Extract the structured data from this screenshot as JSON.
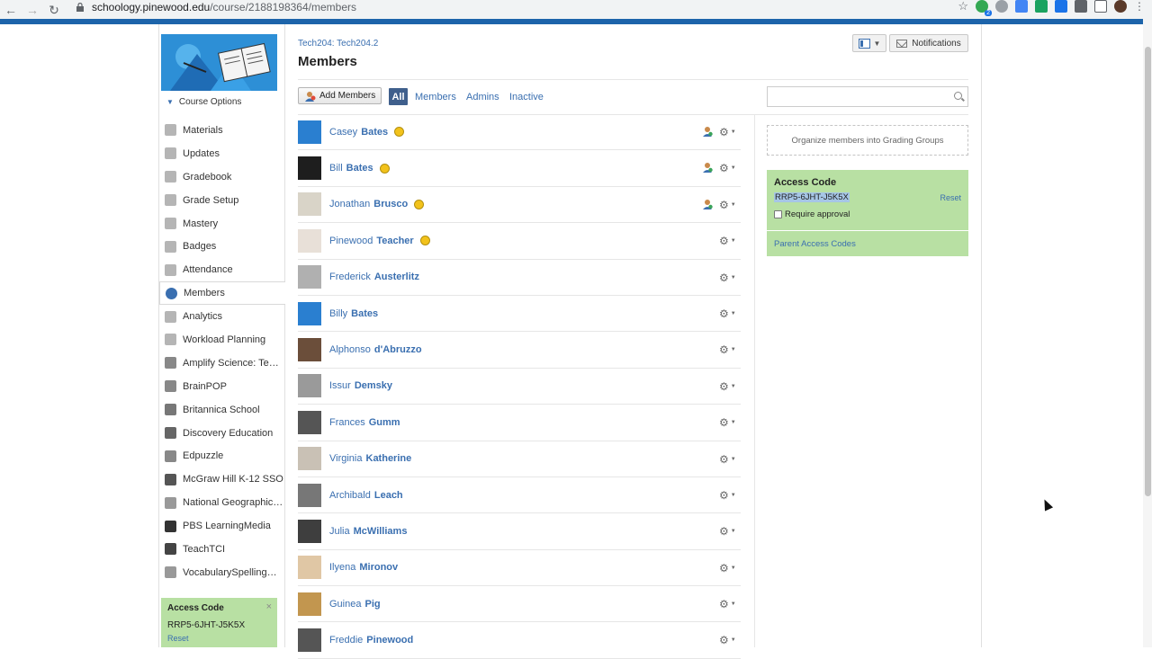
{
  "browser": {
    "url_host": "schoology.pinewood.edu",
    "url_path": "/course/2188198364/members",
    "extension_badge": "2"
  },
  "sidebar": {
    "course_options": "Course Options",
    "items": [
      {
        "label": "Materials",
        "icon": "materials-icon"
      },
      {
        "label": "Updates",
        "icon": "updates-icon"
      },
      {
        "label": "Gradebook",
        "icon": "gradebook-icon"
      },
      {
        "label": "Grade Setup",
        "icon": "grade-setup-icon"
      },
      {
        "label": "Mastery",
        "icon": "mastery-icon"
      },
      {
        "label": "Badges",
        "icon": "badges-icon"
      },
      {
        "label": "Attendance",
        "icon": "attendance-icon"
      },
      {
        "label": "Members",
        "icon": "members-icon"
      },
      {
        "label": "Analytics",
        "icon": "analytics-icon"
      },
      {
        "label": "Workload Planning",
        "icon": "workload-icon"
      },
      {
        "label": "Amplify Science: Teach...",
        "icon": "amplify-icon"
      },
      {
        "label": "BrainPOP",
        "icon": "brainpop-icon"
      },
      {
        "label": "Britannica School",
        "icon": "britannica-icon"
      },
      {
        "label": "Discovery Education",
        "icon": "discovery-icon"
      },
      {
        "label": "Edpuzzle",
        "icon": "edpuzzle-icon"
      },
      {
        "label": "McGraw Hill K-12 SSO",
        "icon": "mcgraw-icon"
      },
      {
        "label": "National Geographic Ki...",
        "icon": "natgeo-icon"
      },
      {
        "label": "PBS LearningMedia",
        "icon": "pbs-icon"
      },
      {
        "label": "TeachTCI",
        "icon": "tci-icon"
      },
      {
        "label": "VocabularySpellingCity",
        "icon": "vocab-icon"
      }
    ],
    "access": {
      "title": "Access Code",
      "code": "RRP5-6JHT-J5K5X",
      "reset": "Reset",
      "close": "×"
    }
  },
  "header": {
    "breadcrumb": "Tech204: Tech204.2",
    "title": "Members",
    "notifications": "Notifications"
  },
  "toolbar": {
    "add_members": "Add Members",
    "tab_all": "All",
    "tab_members": "Members",
    "tab_admins": "Admins",
    "tab_inactive": "Inactive",
    "search_placeholder": ""
  },
  "members": [
    {
      "first": "Casey",
      "last": "Bates",
      "admin": true,
      "role_icon": true
    },
    {
      "first": "Bill",
      "last": "Bates",
      "admin": true,
      "role_icon": true
    },
    {
      "first": "Jonathan",
      "last": "Brusco",
      "admin": true,
      "role_icon": true
    },
    {
      "first": "Pinewood",
      "last": "Teacher",
      "admin": true,
      "role_icon": false
    },
    {
      "first": "Frederick",
      "last": "Austerlitz",
      "admin": false,
      "role_icon": false
    },
    {
      "first": "Billy",
      "last": "Bates",
      "admin": false,
      "role_icon": false
    },
    {
      "first": "Alphonso",
      "last": "d'Abruzzo",
      "admin": false,
      "role_icon": false
    },
    {
      "first": "Issur",
      "last": "Demsky",
      "admin": false,
      "role_icon": false
    },
    {
      "first": "Frances",
      "last": "Gumm",
      "admin": false,
      "role_icon": false
    },
    {
      "first": "Virginia",
      "last": "Katherine",
      "admin": false,
      "role_icon": false
    },
    {
      "first": "Archibald",
      "last": "Leach",
      "admin": false,
      "role_icon": false
    },
    {
      "first": "Julia",
      "last": "McWilliams",
      "admin": false,
      "role_icon": false
    },
    {
      "first": "Ilyena",
      "last": "Mironov",
      "admin": false,
      "role_icon": false
    },
    {
      "first": "Guinea",
      "last": "Pig",
      "admin": false,
      "role_icon": false
    },
    {
      "first": "Freddie",
      "last": "Pinewood",
      "admin": false,
      "role_icon": false
    }
  ],
  "right": {
    "grading_groups": "Organize members into Grading Groups",
    "access_title": "Access Code",
    "access_code": "RRP5-6JHT-J5K5X",
    "access_reset": "Reset",
    "require_approval": "Require approval",
    "parent_codes": "Parent Access Codes"
  },
  "colors": {
    "accent": "#3a6fb0",
    "green": "#b8e0a3",
    "topbar": "#1d64aa",
    "tab_active": "#3f5f8c"
  }
}
